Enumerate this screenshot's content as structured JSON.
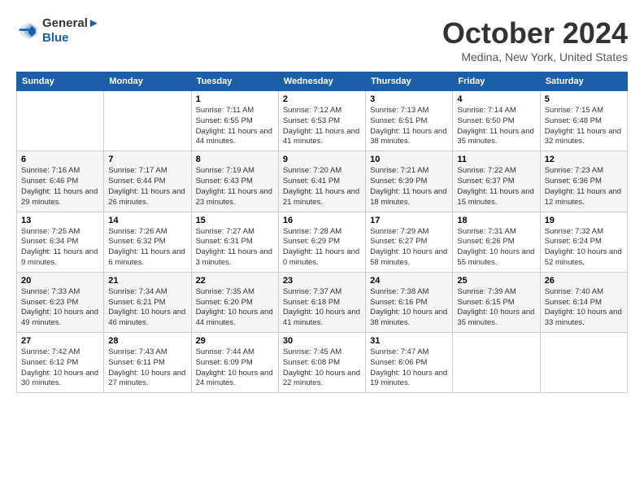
{
  "logo": {
    "text1": "General",
    "text2": "Blue"
  },
  "title": "October 2024",
  "location": "Medina, New York, United States",
  "days_of_week": [
    "Sunday",
    "Monday",
    "Tuesday",
    "Wednesday",
    "Thursday",
    "Friday",
    "Saturday"
  ],
  "weeks": [
    [
      {
        "day": "",
        "sunrise": "",
        "sunset": "",
        "daylight": ""
      },
      {
        "day": "",
        "sunrise": "",
        "sunset": "",
        "daylight": ""
      },
      {
        "day": "1",
        "sunrise": "Sunrise: 7:11 AM",
        "sunset": "Sunset: 6:55 PM",
        "daylight": "Daylight: 11 hours and 44 minutes."
      },
      {
        "day": "2",
        "sunrise": "Sunrise: 7:12 AM",
        "sunset": "Sunset: 6:53 PM",
        "daylight": "Daylight: 11 hours and 41 minutes."
      },
      {
        "day": "3",
        "sunrise": "Sunrise: 7:13 AM",
        "sunset": "Sunset: 6:51 PM",
        "daylight": "Daylight: 11 hours and 38 minutes."
      },
      {
        "day": "4",
        "sunrise": "Sunrise: 7:14 AM",
        "sunset": "Sunset: 6:50 PM",
        "daylight": "Daylight: 11 hours and 35 minutes."
      },
      {
        "day": "5",
        "sunrise": "Sunrise: 7:15 AM",
        "sunset": "Sunset: 6:48 PM",
        "daylight": "Daylight: 11 hours and 32 minutes."
      }
    ],
    [
      {
        "day": "6",
        "sunrise": "Sunrise: 7:16 AM",
        "sunset": "Sunset: 6:46 PM",
        "daylight": "Daylight: 11 hours and 29 minutes."
      },
      {
        "day": "7",
        "sunrise": "Sunrise: 7:17 AM",
        "sunset": "Sunset: 6:44 PM",
        "daylight": "Daylight: 11 hours and 26 minutes."
      },
      {
        "day": "8",
        "sunrise": "Sunrise: 7:19 AM",
        "sunset": "Sunset: 6:43 PM",
        "daylight": "Daylight: 11 hours and 23 minutes."
      },
      {
        "day": "9",
        "sunrise": "Sunrise: 7:20 AM",
        "sunset": "Sunset: 6:41 PM",
        "daylight": "Daylight: 11 hours and 21 minutes."
      },
      {
        "day": "10",
        "sunrise": "Sunrise: 7:21 AM",
        "sunset": "Sunset: 6:39 PM",
        "daylight": "Daylight: 11 hours and 18 minutes."
      },
      {
        "day": "11",
        "sunrise": "Sunrise: 7:22 AM",
        "sunset": "Sunset: 6:37 PM",
        "daylight": "Daylight: 11 hours and 15 minutes."
      },
      {
        "day": "12",
        "sunrise": "Sunrise: 7:23 AM",
        "sunset": "Sunset: 6:36 PM",
        "daylight": "Daylight: 11 hours and 12 minutes."
      }
    ],
    [
      {
        "day": "13",
        "sunrise": "Sunrise: 7:25 AM",
        "sunset": "Sunset: 6:34 PM",
        "daylight": "Daylight: 11 hours and 9 minutes."
      },
      {
        "day": "14",
        "sunrise": "Sunrise: 7:26 AM",
        "sunset": "Sunset: 6:32 PM",
        "daylight": "Daylight: 11 hours and 6 minutes."
      },
      {
        "day": "15",
        "sunrise": "Sunrise: 7:27 AM",
        "sunset": "Sunset: 6:31 PM",
        "daylight": "Daylight: 11 hours and 3 minutes."
      },
      {
        "day": "16",
        "sunrise": "Sunrise: 7:28 AM",
        "sunset": "Sunset: 6:29 PM",
        "daylight": "Daylight: 11 hours and 0 minutes."
      },
      {
        "day": "17",
        "sunrise": "Sunrise: 7:29 AM",
        "sunset": "Sunset: 6:27 PM",
        "daylight": "Daylight: 10 hours and 58 minutes."
      },
      {
        "day": "18",
        "sunrise": "Sunrise: 7:31 AM",
        "sunset": "Sunset: 6:26 PM",
        "daylight": "Daylight: 10 hours and 55 minutes."
      },
      {
        "day": "19",
        "sunrise": "Sunrise: 7:32 AM",
        "sunset": "Sunset: 6:24 PM",
        "daylight": "Daylight: 10 hours and 52 minutes."
      }
    ],
    [
      {
        "day": "20",
        "sunrise": "Sunrise: 7:33 AM",
        "sunset": "Sunset: 6:23 PM",
        "daylight": "Daylight: 10 hours and 49 minutes."
      },
      {
        "day": "21",
        "sunrise": "Sunrise: 7:34 AM",
        "sunset": "Sunset: 6:21 PM",
        "daylight": "Daylight: 10 hours and 46 minutes."
      },
      {
        "day": "22",
        "sunrise": "Sunrise: 7:35 AM",
        "sunset": "Sunset: 6:20 PM",
        "daylight": "Daylight: 10 hours and 44 minutes."
      },
      {
        "day": "23",
        "sunrise": "Sunrise: 7:37 AM",
        "sunset": "Sunset: 6:18 PM",
        "daylight": "Daylight: 10 hours and 41 minutes."
      },
      {
        "day": "24",
        "sunrise": "Sunrise: 7:38 AM",
        "sunset": "Sunset: 6:16 PM",
        "daylight": "Daylight: 10 hours and 38 minutes."
      },
      {
        "day": "25",
        "sunrise": "Sunrise: 7:39 AM",
        "sunset": "Sunset: 6:15 PM",
        "daylight": "Daylight: 10 hours and 35 minutes."
      },
      {
        "day": "26",
        "sunrise": "Sunrise: 7:40 AM",
        "sunset": "Sunset: 6:14 PM",
        "daylight": "Daylight: 10 hours and 33 minutes."
      }
    ],
    [
      {
        "day": "27",
        "sunrise": "Sunrise: 7:42 AM",
        "sunset": "Sunset: 6:12 PM",
        "daylight": "Daylight: 10 hours and 30 minutes."
      },
      {
        "day": "28",
        "sunrise": "Sunrise: 7:43 AM",
        "sunset": "Sunset: 6:11 PM",
        "daylight": "Daylight: 10 hours and 27 minutes."
      },
      {
        "day": "29",
        "sunrise": "Sunrise: 7:44 AM",
        "sunset": "Sunset: 6:09 PM",
        "daylight": "Daylight: 10 hours and 24 minutes."
      },
      {
        "day": "30",
        "sunrise": "Sunrise: 7:45 AM",
        "sunset": "Sunset: 6:08 PM",
        "daylight": "Daylight: 10 hours and 22 minutes."
      },
      {
        "day": "31",
        "sunrise": "Sunrise: 7:47 AM",
        "sunset": "Sunset: 6:06 PM",
        "daylight": "Daylight: 10 hours and 19 minutes."
      },
      {
        "day": "",
        "sunrise": "",
        "sunset": "",
        "daylight": ""
      },
      {
        "day": "",
        "sunrise": "",
        "sunset": "",
        "daylight": ""
      }
    ]
  ]
}
